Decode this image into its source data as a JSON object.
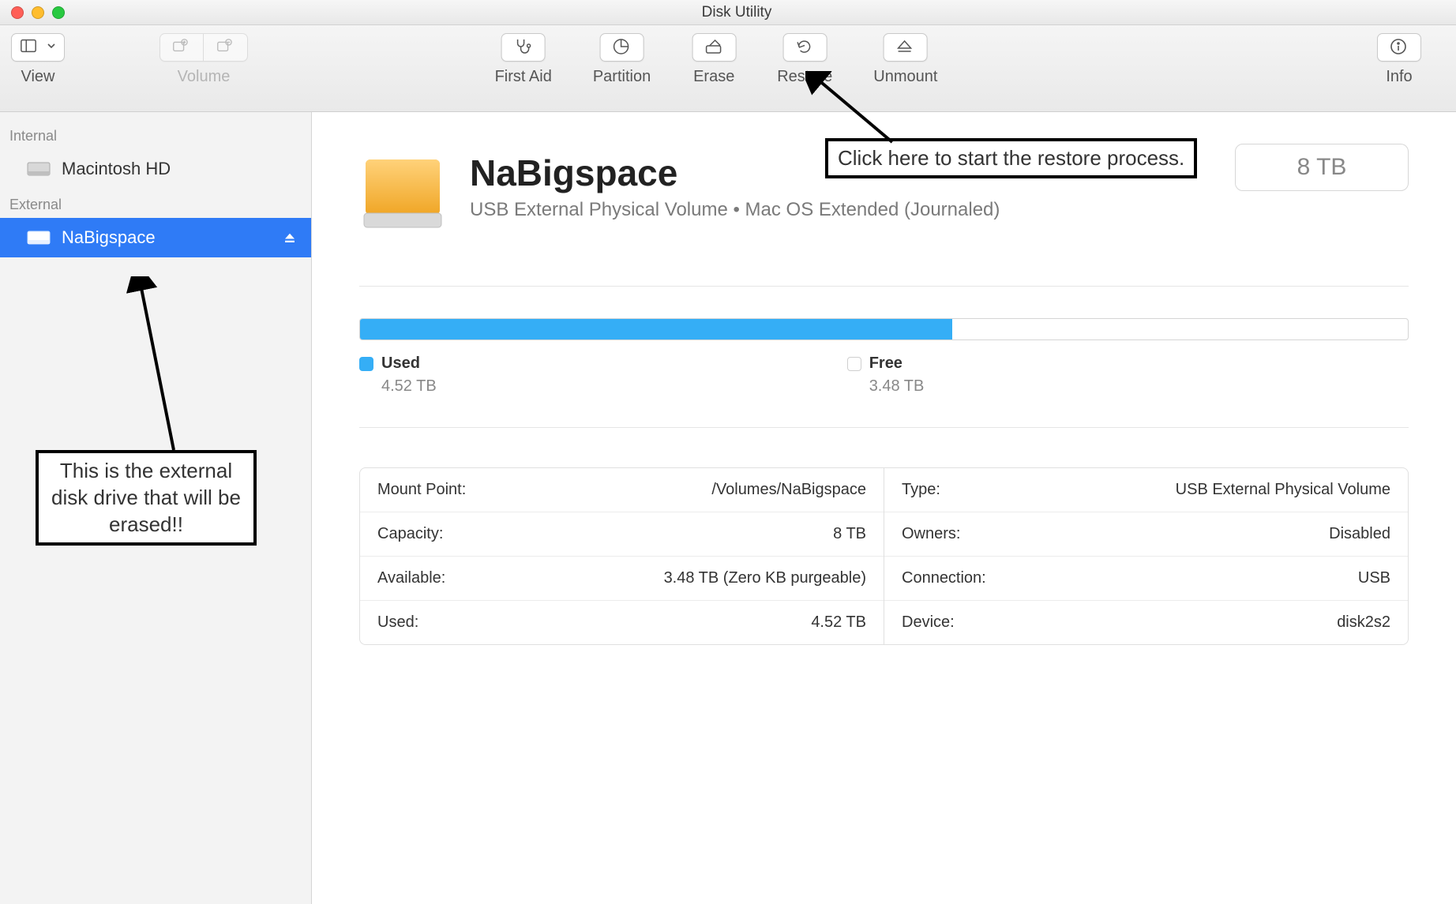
{
  "window": {
    "title": "Disk Utility"
  },
  "toolbar": {
    "view_label": "View",
    "volume_label": "Volume",
    "first_aid": "First Aid",
    "partition": "Partition",
    "erase": "Erase",
    "restore": "Restore",
    "unmount": "Unmount",
    "info": "Info"
  },
  "sidebar": {
    "internal_header": "Internal",
    "external_header": "External",
    "internal_items": [
      {
        "label": "Macintosh HD"
      }
    ],
    "external_items": [
      {
        "label": "NaBigspace",
        "selected": true
      }
    ]
  },
  "volume": {
    "name": "NaBigspace",
    "subtitle": "USB External Physical Volume • Mac OS Extended (Journaled)",
    "size_chip": "8 TB"
  },
  "usage": {
    "used_label": "Used",
    "used_value": "4.52 TB",
    "free_label": "Free",
    "free_value": "3.48 TB",
    "used_percent": 56.5
  },
  "details": {
    "left": [
      {
        "k": "Mount Point:",
        "v": "/Volumes/NaBigspace"
      },
      {
        "k": "Capacity:",
        "v": "8 TB"
      },
      {
        "k": "Available:",
        "v": "3.48 TB (Zero KB purgeable)"
      },
      {
        "k": "Used:",
        "v": "4.52 TB"
      }
    ],
    "right": [
      {
        "k": "Type:",
        "v": "USB External Physical Volume"
      },
      {
        "k": "Owners:",
        "v": "Disabled"
      },
      {
        "k": "Connection:",
        "v": "USB"
      },
      {
        "k": "Device:",
        "v": "disk2s2"
      }
    ]
  },
  "annotations": {
    "restore_note": "Click here to start the restore process.",
    "external_note": "This is the external disk drive that will be erased!!"
  }
}
